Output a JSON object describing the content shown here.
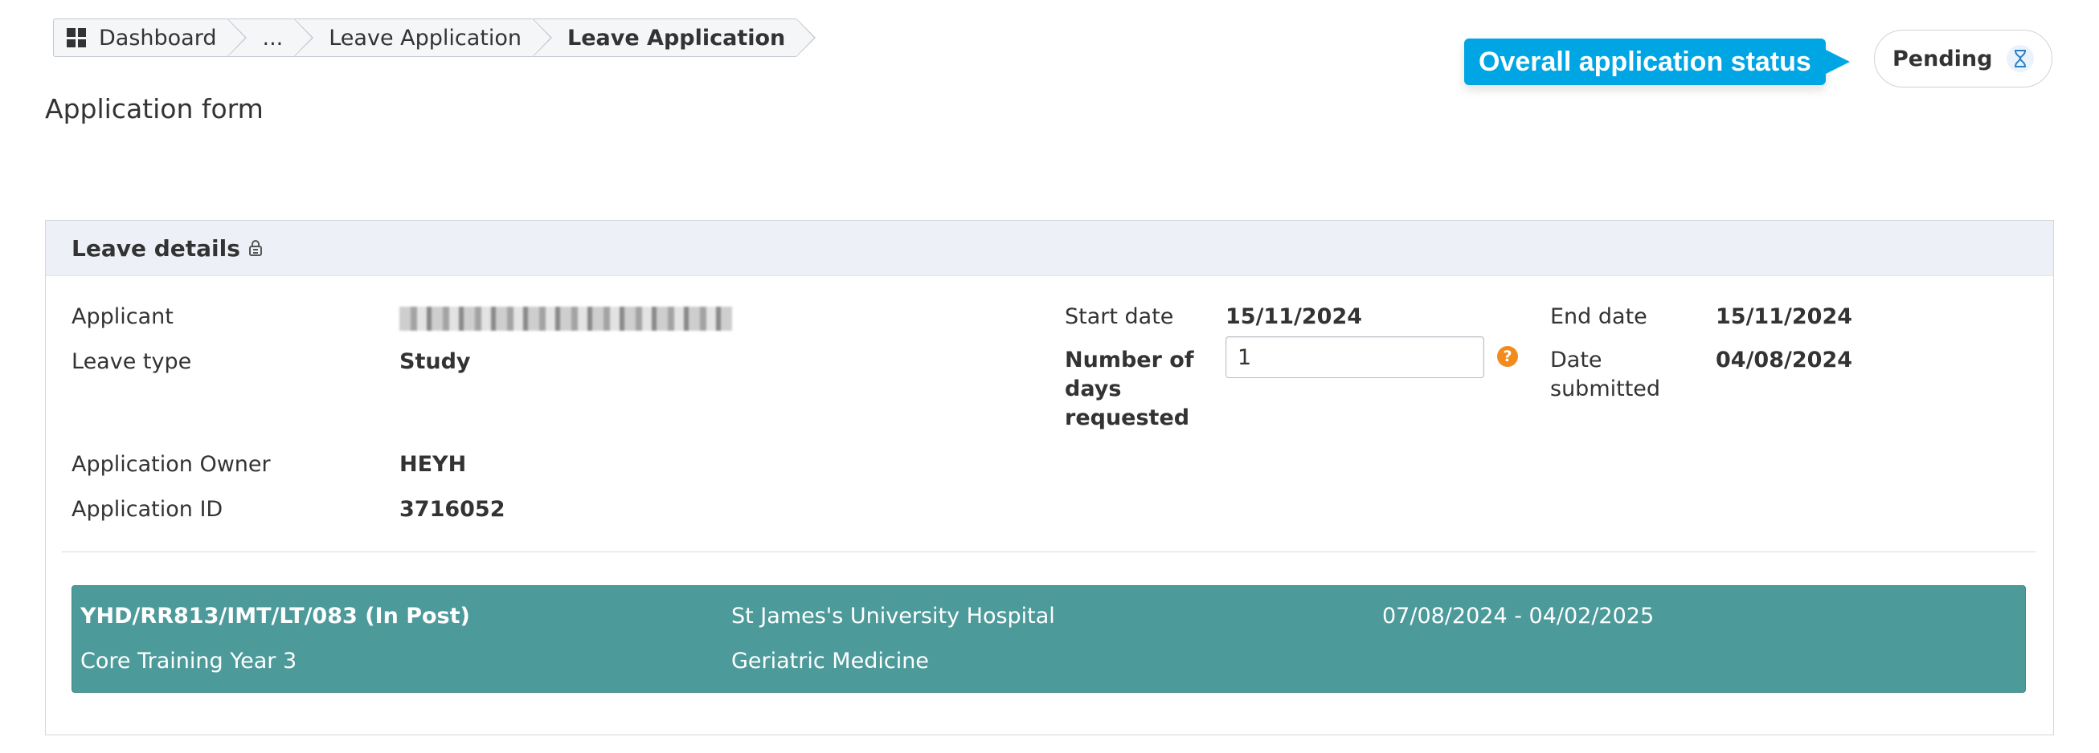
{
  "breadcrumb": {
    "items": [
      {
        "label": "Dashboard",
        "icon": "dashboard-grid-icon"
      },
      {
        "label": "..."
      },
      {
        "label": "Leave Application"
      },
      {
        "label": "Leave Application",
        "current": true
      }
    ]
  },
  "page": {
    "title": "Application form"
  },
  "status": {
    "tooltip": "Overall application status",
    "value": "Pending",
    "icon": "hourglass-icon",
    "tooltip_color": "#00a6e4"
  },
  "panel": {
    "title": "Leave details",
    "title_icon": "lock-icon",
    "applicant_label": "Applicant",
    "leave_type_label": "Leave type",
    "leave_type_value": "Study",
    "owner_label": "Application Owner",
    "owner_value": "HEYH",
    "app_id_label": "Application ID",
    "app_id_value": "3716052",
    "start_date_label": "Start date",
    "start_date_value": "15/11/2024",
    "days_label": "Number of days requested",
    "days_value": "1",
    "end_date_label": "End date",
    "end_date_value": "15/11/2024",
    "submitted_label": "Date submitted",
    "submitted_value": "04/08/2024"
  },
  "post": {
    "code": "YHD/RR813/IMT/LT/083 (In Post)",
    "grade": "Core Training Year 3",
    "hospital": "St James's University Hospital",
    "specialty": "Geriatric Medicine",
    "dates": "07/08/2024 - 04/02/2025",
    "bar_color": "#4d9a9b"
  }
}
